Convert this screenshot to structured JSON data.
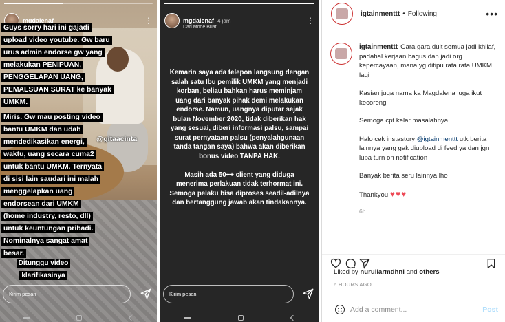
{
  "story1": {
    "username": "mgdalenaf",
    "time": "",
    "progress": 0.4,
    "text_top": "Guys sorry hari ini gajadi upload video youtube. Gw baru urus admin endorse gw yang melakukan PENIPUAN, PENGGELAPAN UANG, PEMALSUAN SURAT ke banyak UMKM.",
    "text_mid": "Miris. Gw mau posting video bantu UMKM dan udah mendedikasikan energi, waktu, uang secara cuma2 untuk bantu UMKM. Ternyata di sisi lain saudari ini malah menggelapkan uang endorsean dari UMKM (home industry, resto, dll) untuk keuntungan pribadi. Nominalnya sangat amat besar.",
    "text_bottom": "Ditunggu video klarifikasinya",
    "tag": "@gitaacinta",
    "message_placeholder": "Kirim pesan"
  },
  "story2": {
    "username": "mgdalenaf",
    "time": "4 jam",
    "subtitle": "Dari Mode Buat",
    "progress": 1,
    "paragraph1": "Kemarin saya ada telepon langsung dengan salah satu Ibu pemilik UMKM yang menjadi korban, beliau bahkan harus meminjam uang dari banyak pihak demi melakukan endorse. Namun, uangnya diputar sejak bulan November 2020, tidak diberikan hak yang sesuai, diberi informasi palsu, sampai surat pernyataan palsu (penyalahgunaan tanda tangan saya) bahwa akan diberikan bonus video TANPA HAK.",
    "paragraph2": "Masih ada 50++ client yang diduga menerima perlakuan tidak terhormat ini. Semoga pelaku bisa diproses seadil-adilnya dan bertanggung jawab akan tindakannya.",
    "message_placeholder": "Kirim pesan"
  },
  "panel": {
    "username": "igtainmenttt",
    "separator": "•",
    "following": "Following",
    "more": "•••",
    "caption_user": "igtainmenttt",
    "caption_p1": "Gara gara duit semua jadi khilaf, padahal kerjaan bagus dan jadi org kepercayaan, mana yg ditipu rata rata UMKM lagi",
    "caption_p2": "Kasian juga nama ka Magdalena juga ikut kecoreng",
    "caption_p3": "Semoga cpt kelar masalahnya",
    "caption_p4_pre": "Halo cek instastory ",
    "caption_p4_mention": "@igtainmenttt",
    "caption_p4_post": " utk berita lainnya yang gak diupload di feed ya dan jgn lupa turn on notification",
    "caption_p5": "Banyak berita seru lainnya lho",
    "caption_p6": "Thankyou",
    "hearts": "♥♥♥",
    "caption_time": "6h",
    "liked_by_prefix": "Liked by ",
    "liked_by_user": "nuruliarmdhni",
    "liked_by_mid": " and ",
    "liked_by_others": "others",
    "posted_ago": "6 HOURS AGO",
    "comment_placeholder": "Add a comment...",
    "post_label": "Post",
    "colors": {
      "mention": "#00376b",
      "heart": "#ed4956",
      "post_disabled": "#b2dffc"
    }
  }
}
